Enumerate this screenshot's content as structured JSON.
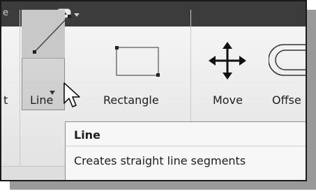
{
  "titlebar": {
    "title_fragment": "e"
  },
  "ribbon": {
    "left_cut_label": "t",
    "line_label": "Line",
    "rectangle_label": "Rectangle",
    "move_label": "Move",
    "offset_label": "Offse"
  },
  "tooltip": {
    "title": "Line",
    "description": "Creates straight line segments"
  },
  "icons": [
    "quick-access-icon",
    "line-icon",
    "rectangle-icon",
    "move-icon",
    "offset-icon",
    "cursor-icon"
  ]
}
